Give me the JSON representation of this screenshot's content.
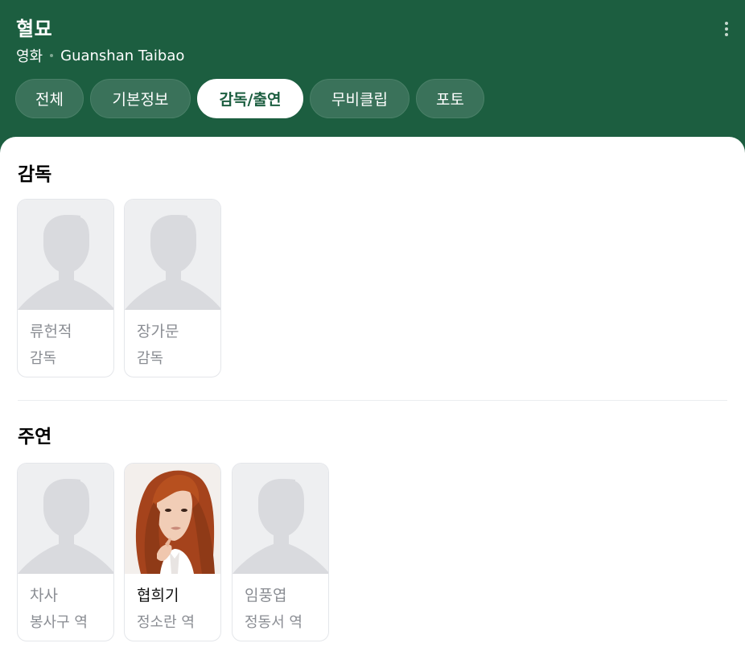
{
  "header": {
    "title": "혈묘",
    "category": "영화",
    "original_title": "Guanshan Taibao",
    "more_icon": "more-vertical-icon"
  },
  "tabs": [
    {
      "label": "전체",
      "active": false
    },
    {
      "label": "기본정보",
      "active": false
    },
    {
      "label": "감독/출연",
      "active": true
    },
    {
      "label": "무비클립",
      "active": false
    },
    {
      "label": "포토",
      "active": false
    }
  ],
  "directors": {
    "title": "감독",
    "people": [
      {
        "name": "류헌적",
        "role": "감독",
        "photo": "placeholder-silhouette"
      },
      {
        "name": "장가문",
        "role": "감독",
        "photo": "placeholder-silhouette"
      }
    ]
  },
  "cast": {
    "title": "주연",
    "people": [
      {
        "name": "차사",
        "role": "봉사구 역",
        "photo": "placeholder-silhouette"
      },
      {
        "name": "협희기",
        "role": "정소란 역",
        "photo": "portrait-photo"
      },
      {
        "name": "임풍엽",
        "role": "정동서 역",
        "photo": "placeholder-silhouette"
      }
    ]
  },
  "colors": {
    "header_bg": "#1c5e40",
    "tab_bg": "#3a725a",
    "active_tab_bg": "#ffffff",
    "active_tab_text": "#1c5e40",
    "placeholder_bg": "#eeeff1",
    "silhouette": "#d9dade"
  }
}
